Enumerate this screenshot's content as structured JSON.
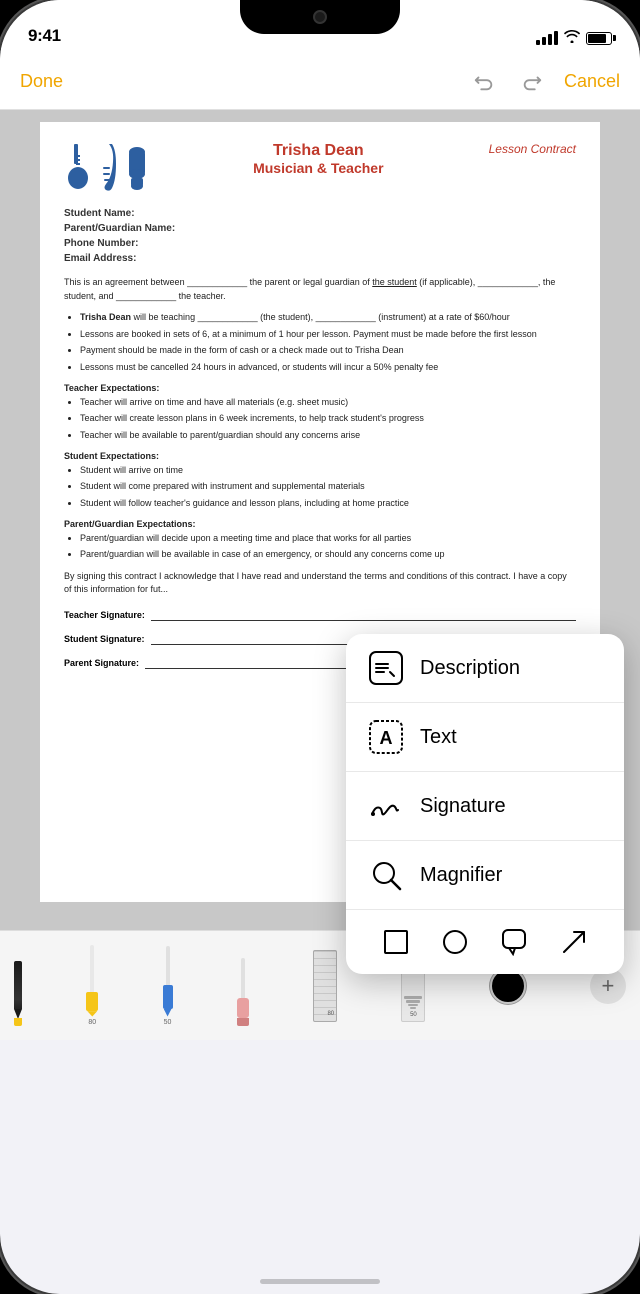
{
  "statusBar": {
    "time": "9:41"
  },
  "navBar": {
    "doneLabel": "Done",
    "cancelLabel": "Cancel"
  },
  "document": {
    "title": "Trisha Dean",
    "subtitle": "Musician & Teacher",
    "docType": "Lesson Contract",
    "fields": [
      "Student Name:",
      "Parent/Guardian Name:",
      "Phone Number:",
      "Email Address:"
    ],
    "agreement": "This is an agreement between ____________ the parent or legal guardian of the student (if applicable), ____________, the student, and ____________ the teacher.",
    "bullets": [
      "Trisha Dean will be teaching ____________ (the student), ____________ (instrument) at a rate of $60/hour",
      "Lessons are booked in sets of 6, at a minimum of 1 hour per lesson. Payment must be made before the first lesson",
      "Payment should be made in the form of cash or a check made out to Trisha Dean",
      "Lessons must be cancelled 24 hours in advanced, or students will incur a 50% penalty fee"
    ],
    "sections": [
      {
        "title": "Teacher Expectations:",
        "items": [
          "Teacher will arrive on time and have all materials (e.g. sheet music)",
          "Teacher will create lesson plans in 6 week increments, to help track student's progress",
          "Teacher will be available to parent/guardian should any concerns arise"
        ]
      },
      {
        "title": "Student Expectations:",
        "items": [
          "Student will arrive on time",
          "Student will come prepared with instrument and supplemental materials",
          "Student will follow teacher's guidance and lesson plans, including at home practice"
        ]
      },
      {
        "title": "Parent/Guardian Expectations:",
        "items": [
          "Parent/guardian will decide upon a meeting time and place that works for all parties",
          "Parent/guardian will be available in case of an emergency, or should any concerns come up"
        ]
      }
    ],
    "closingText": "By signing this contract I acknowledge that I have read and understand the terms and conditions of this contract. I have a copy of this information for fut...",
    "signatures": [
      "Teacher Signature:",
      "Student Signature:",
      "Parent Signature:"
    ]
  },
  "popupMenu": {
    "items": [
      {
        "id": "description",
        "label": "Description",
        "icon": "💬"
      },
      {
        "id": "text",
        "label": "Text",
        "icon": "🅰"
      },
      {
        "id": "signature",
        "label": "Signature",
        "icon": "✍"
      },
      {
        "id": "magnifier",
        "label": "Magnifier",
        "icon": "🔍"
      }
    ],
    "shapes": [
      "□",
      "○",
      "💬",
      "↗"
    ]
  },
  "toolbar": {
    "tools": [
      "pencil",
      "highlighter-yellow",
      "pen-blue",
      "eraser",
      "ruler",
      "size"
    ],
    "rulerLabel": "80",
    "sizeLabel": "50"
  }
}
